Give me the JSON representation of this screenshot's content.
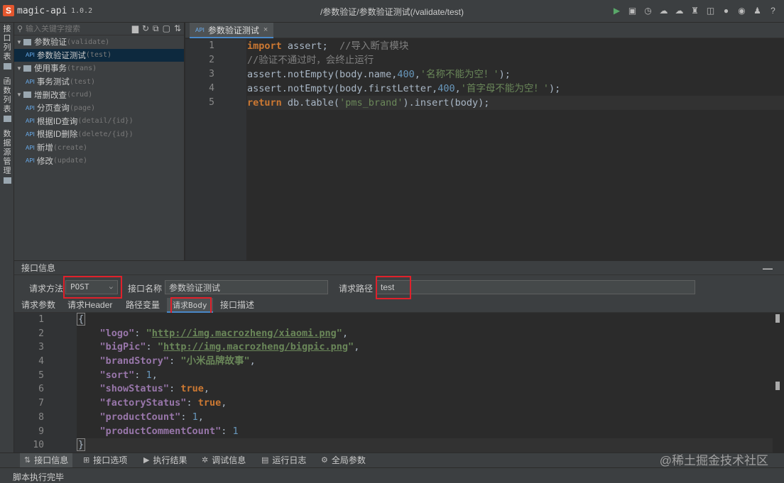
{
  "app": {
    "name": "magic-api",
    "version": "1.0.2",
    "path_title": "/参数验证/参数验证测试(/validate/test)"
  },
  "toolbar_icons": [
    "run-icon",
    "save-icon",
    "history-icon",
    "upload-icon",
    "download-icon",
    "skin-icon",
    "push-icon",
    "gitee-icon",
    "github-icon",
    "qq-icon",
    "help-icon"
  ],
  "side_tabs": [
    {
      "label": "接口列表"
    },
    {
      "label": "函数列表"
    },
    {
      "label": "数据源管理"
    }
  ],
  "tree": {
    "search_placeholder": "输入关键字搜索",
    "api_badge": "API",
    "items": [
      {
        "type": "group",
        "name": "参数验证",
        "path": "(validate)"
      },
      {
        "type": "leaf",
        "name": "参数验证测试",
        "path": "(test)",
        "selected": true
      },
      {
        "type": "group",
        "name": "使用事务",
        "path": "(trans)"
      },
      {
        "type": "leaf",
        "name": "事务测试",
        "path": "(test)"
      },
      {
        "type": "group",
        "name": "增删改查",
        "path": "(crud)"
      },
      {
        "type": "leaf",
        "name": "分页查询",
        "path": "(page)"
      },
      {
        "type": "leaf",
        "name": "根据ID查询",
        "path": "(detail/{id})"
      },
      {
        "type": "leaf",
        "name": "根据ID删除",
        "path": "(delete/{id})"
      },
      {
        "type": "leaf",
        "name": "新增",
        "path": "(create)"
      },
      {
        "type": "leaf",
        "name": "修改",
        "path": "(update)"
      }
    ]
  },
  "editor": {
    "tab_label": "参数验证测试",
    "tab_close": "×",
    "line_numbers": [
      "1",
      "2",
      "3",
      "4",
      "5"
    ]
  },
  "info": {
    "title": "接口信息",
    "minimize": "—",
    "method_label": "请求方法",
    "method_value": "POST",
    "name_label": "接口名称",
    "name_value": "参数验证测试",
    "path_label": "请求路径",
    "path_value": "test",
    "subtabs": [
      "请求参数",
      "请求Header",
      "路径变量",
      "请求Body",
      "接口描述"
    ],
    "body_line_numbers": [
      "1",
      "2",
      "3",
      "4",
      "5",
      "6",
      "7",
      "8",
      "9",
      "10"
    ]
  },
  "bottom_tabs": [
    "接口信息",
    "接口选项",
    "执行结果",
    "调试信息",
    "运行日志",
    "全局参数"
  ],
  "watermark": "@稀土掘金技术社区",
  "status": "脚本执行完毕"
}
